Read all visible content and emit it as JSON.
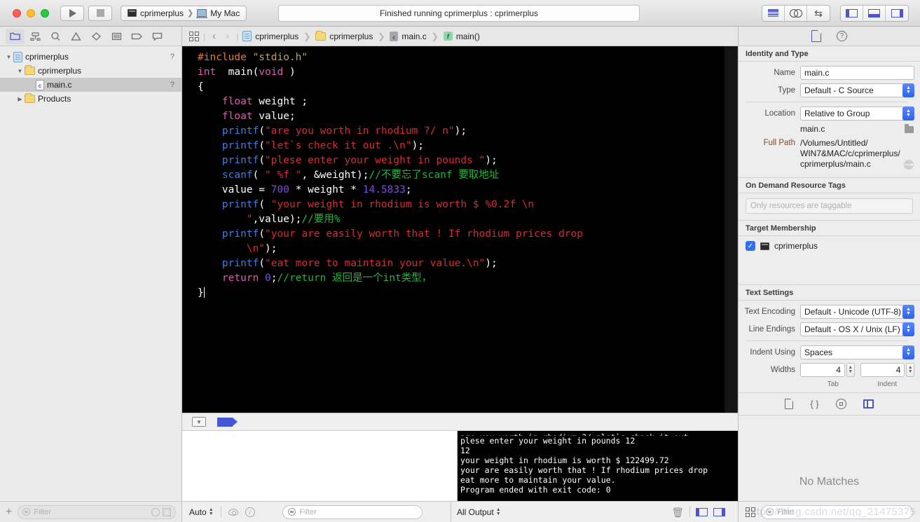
{
  "titlebar": {
    "scheme_target": "cprimerplus",
    "scheme_device": "My Mac",
    "status": "Finished running cprimerplus : cprimerplus",
    "run_icon": "play-icon",
    "stop_icon": "stop-icon"
  },
  "navigator": {
    "tabs": [
      "folder-icon",
      "source-control-icon",
      "search-icon",
      "warning-icon",
      "test-icon",
      "debug-icon",
      "breakpoint-icon",
      "report-icon"
    ],
    "tree": [
      {
        "label": "cprimerplus",
        "icon": "project-icon",
        "depth": 0,
        "twisty": "open",
        "badge": "?",
        "selected": false
      },
      {
        "label": "cprimerplus",
        "icon": "folder-icon",
        "depth": 1,
        "twisty": "open",
        "badge": "",
        "selected": false
      },
      {
        "label": "main.c",
        "icon": "c-file-icon",
        "depth": 2,
        "twisty": "none",
        "badge": "?",
        "selected": true
      },
      {
        "label": "Products",
        "icon": "folder-icon",
        "depth": 1,
        "twisty": "closed",
        "badge": "",
        "selected": false
      }
    ],
    "filter_placeholder": "Filter",
    "add_label": "+"
  },
  "jumpbar": {
    "crumbs": [
      "cprimerplus",
      "cprimerplus",
      "main.c",
      "main()"
    ],
    "back": "‹",
    "forward": "›"
  },
  "editor": {
    "lines": [
      [
        {
          "t": "#include ",
          "c": "pre"
        },
        {
          "t": "\"stdio.h\"",
          "c": "strh"
        }
      ],
      [
        {
          "t": "int",
          "c": "kw"
        },
        {
          "t": "  main(",
          "c": "pl"
        },
        {
          "t": "void",
          "c": "kw"
        },
        {
          "t": " )",
          "c": "pl"
        }
      ],
      [
        {
          "t": "{",
          "c": "pl"
        }
      ],
      [
        {
          "t": "    ",
          "c": "pl"
        },
        {
          "t": "float",
          "c": "kw"
        },
        {
          "t": " weight ;",
          "c": "pl"
        }
      ],
      [
        {
          "t": "    ",
          "c": "pl"
        },
        {
          "t": "float",
          "c": "kw"
        },
        {
          "t": " value;",
          "c": "pl"
        }
      ],
      [
        {
          "t": "    ",
          "c": "pl"
        },
        {
          "t": "printf",
          "c": "fn"
        },
        {
          "t": "(",
          "c": "pl"
        },
        {
          "t": "\"are you worth in rhodium ?/ n\"",
          "c": "str"
        },
        {
          "t": ");",
          "c": "pl"
        }
      ],
      [
        {
          "t": "    ",
          "c": "pl"
        },
        {
          "t": "printf",
          "c": "fn"
        },
        {
          "t": "(",
          "c": "pl"
        },
        {
          "t": "\"let`s check it out .\\n\"",
          "c": "str"
        },
        {
          "t": ");",
          "c": "pl"
        }
      ],
      [
        {
          "t": "    ",
          "c": "pl"
        },
        {
          "t": "printf",
          "c": "fn"
        },
        {
          "t": "(",
          "c": "pl"
        },
        {
          "t": "\"plese enter your weight in pounds \"",
          "c": "str"
        },
        {
          "t": ");",
          "c": "pl"
        }
      ],
      [
        {
          "t": "    ",
          "c": "pl"
        },
        {
          "t": "scanf",
          "c": "fn"
        },
        {
          "t": "( ",
          "c": "pl"
        },
        {
          "t": "\" %f \"",
          "c": "str"
        },
        {
          "t": ", &weight);",
          "c": "pl"
        },
        {
          "t": "//不要忘了scanf 要取地址",
          "c": "cm"
        }
      ],
      [
        {
          "t": "    value = ",
          "c": "pl"
        },
        {
          "t": "700",
          "c": "num"
        },
        {
          "t": " * weight * ",
          "c": "pl"
        },
        {
          "t": "14.5833",
          "c": "num"
        },
        {
          "t": ";",
          "c": "pl"
        }
      ],
      [
        {
          "t": "    ",
          "c": "pl"
        },
        {
          "t": "printf",
          "c": "fn"
        },
        {
          "t": "( ",
          "c": "pl"
        },
        {
          "t": "\"your weight in rhodium is worth $ %0.2f \\n",
          "c": "str"
        }
      ],
      [
        {
          "t": "        ",
          "c": "pl"
        },
        {
          "t": "\"",
          "c": "str"
        },
        {
          "t": ",value);",
          "c": "pl"
        },
        {
          "t": "//要用%",
          "c": "cm"
        }
      ],
      [
        {
          "t": "    ",
          "c": "pl"
        },
        {
          "t": "printf",
          "c": "fn"
        },
        {
          "t": "(",
          "c": "pl"
        },
        {
          "t": "\"your are easily worth that ! If rhodium prices drop",
          "c": "str"
        }
      ],
      [
        {
          "t": "        ",
          "c": "pl"
        },
        {
          "t": "\\n\"",
          "c": "str"
        },
        {
          "t": ");",
          "c": "pl"
        }
      ],
      [
        {
          "t": "    ",
          "c": "pl"
        },
        {
          "t": "printf",
          "c": "fn"
        },
        {
          "t": "(",
          "c": "pl"
        },
        {
          "t": "\"eat more to maintain your value.\\n\"",
          "c": "str"
        },
        {
          "t": ");",
          "c": "pl"
        }
      ],
      [
        {
          "t": "    ",
          "c": "pl"
        },
        {
          "t": "return",
          "c": "kw"
        },
        {
          "t": " ",
          "c": "pl"
        },
        {
          "t": "0",
          "c": "num"
        },
        {
          "t": ";",
          "c": "pl"
        },
        {
          "t": "//return 返回是一个int类型，",
          "c": "cm"
        }
      ],
      [
        {
          "t": "}",
          "c": "pl"
        }
      ]
    ]
  },
  "console": {
    "lines": [
      "are you worth in rhodium ?/ nlet`s check it out .",
      "plese enter your weight in pounds 12",
      "12",
      "your weight in rhodium is worth $ 122499.72",
      " your are easily worth that ! If rhodium prices drop",
      "eat more to maintain your value.",
      "Program ended with exit code: 0"
    ]
  },
  "debugbar": {
    "variables_scope": "Auto",
    "filter_placeholder": "Filter",
    "output_scope": "All Output",
    "trash_icon": "trash-icon"
  },
  "inspector": {
    "tabs": [
      "file-inspector-icon",
      "quick-help-icon"
    ],
    "identity": {
      "header": "Identity and Type",
      "name_label": "Name",
      "name_value": "main.c",
      "type_label": "Type",
      "type_value": "Default - C Source",
      "location_label": "Location",
      "location_value": "Relative to Group",
      "location_file": "main.c",
      "fullpath_label": "Full Path",
      "fullpath_value": "/Volumes/Untitled/ WIN7&MAC/c/cprimerplus/ cprimerplus/main.c",
      "fullpath_lines": [
        "/Volumes/Untitled/",
        "WIN7&MAC/c/cprimerplus/",
        "cprimerplus/main.c"
      ]
    },
    "odr": {
      "header": "On Demand Resource Tags",
      "placeholder": "Only resources are taggable"
    },
    "target": {
      "header": "Target Membership",
      "item": "cprimerplus",
      "checked": true
    },
    "text_settings": {
      "header": "Text Settings",
      "encoding_label": "Text Encoding",
      "encoding_value": "Default - Unicode (UTF-8)",
      "endings_label": "Line Endings",
      "endings_value": "Default - OS X / Unix (LF)",
      "indent_label": "Indent Using",
      "indent_value": "Spaces",
      "widths_label": "Widths",
      "tab_width": "4",
      "indent_width": "4",
      "tab_sublabel": "Tab",
      "indent_sublabel": "Indent"
    },
    "quickhelp": "No Matches",
    "filter_placeholder": "Filter"
  },
  "watermark": "https://blog.csdn.net/qq_21475375"
}
